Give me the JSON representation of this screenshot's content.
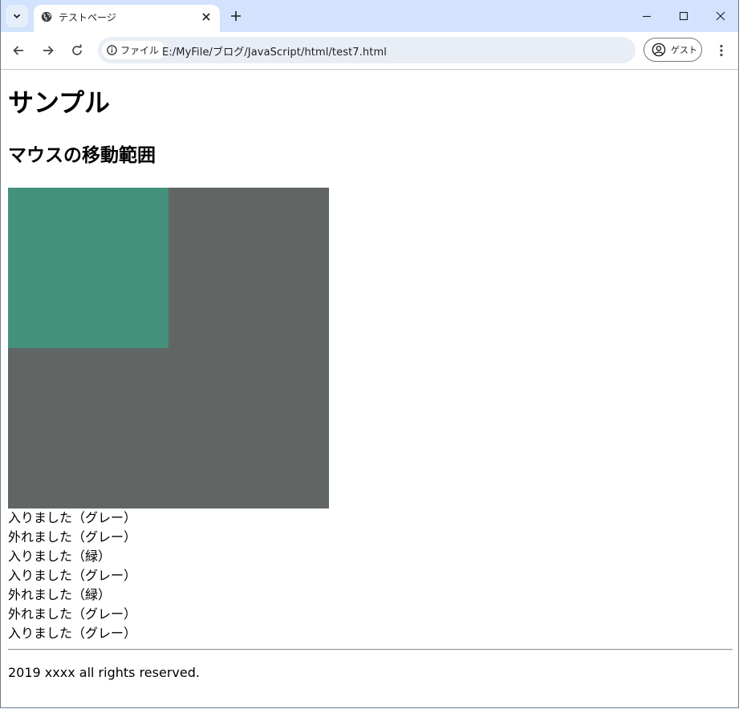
{
  "tab": {
    "title": "テストページ"
  },
  "omnibox": {
    "chip_label": "ファイル",
    "url": "E:/MyFile/ブログ/JavaScript/html/test7.html"
  },
  "profile": {
    "label": "ゲスト"
  },
  "page": {
    "heading": "サンプル",
    "subheading": "マウスの移動範囲",
    "colors": {
      "outer": "#616664",
      "inner": "#44917c"
    },
    "log": [
      "入りました（グレー）",
      "外れました（グレー）",
      "入りました（緑）",
      "入りました（グレー）",
      "外れました（緑）",
      "外れました（グレー）",
      "入りました（グレー）"
    ],
    "footer": "2019 xxxx all rights reserved."
  }
}
